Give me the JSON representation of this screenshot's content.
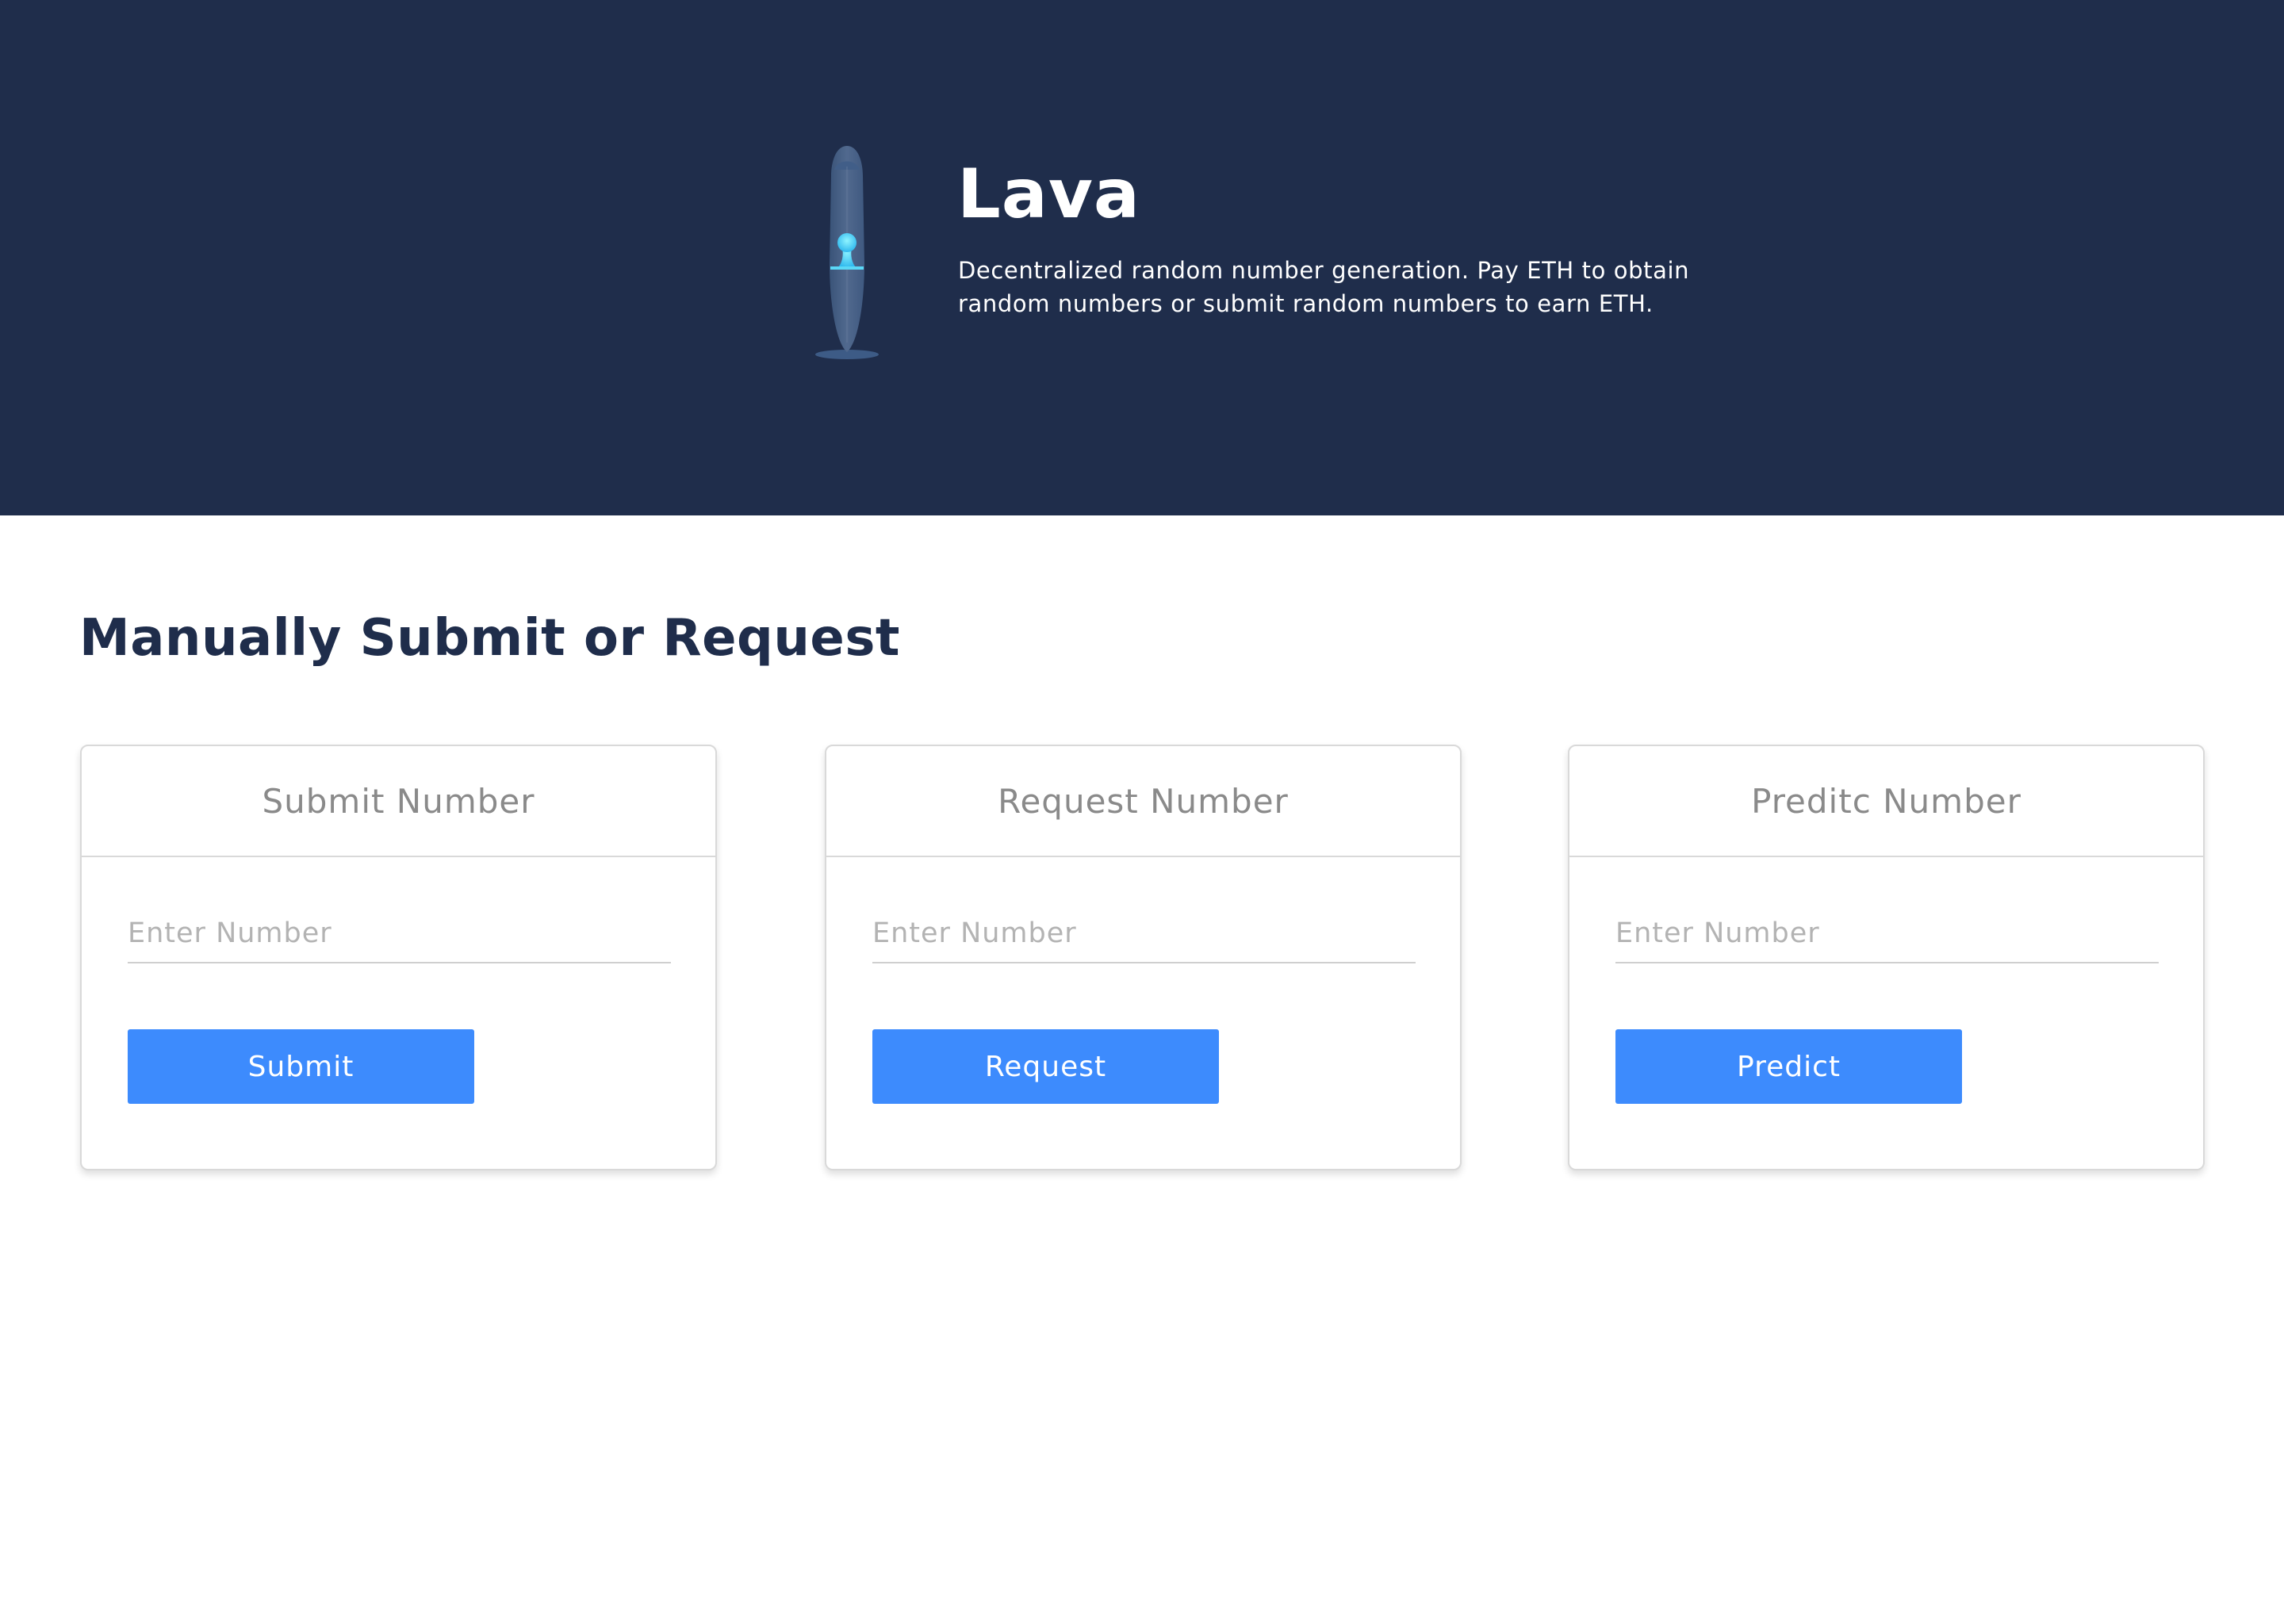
{
  "hero": {
    "title": "Lava",
    "description": "Decentralized random number generation. Pay ETH to obtain random numbers or submit  random numbers to earn ETH.",
    "background_color": "#1f2d4b",
    "logo_icon": "lava-lamp-icon"
  },
  "section": {
    "title": "Manually Submit or Request"
  },
  "cards": [
    {
      "title": "Submit Number",
      "input_placeholder": "Enter Number",
      "input_value": "",
      "button_label": "Submit"
    },
    {
      "title": "Request Number",
      "input_placeholder": "Enter Number",
      "input_value": "",
      "button_label": "Request"
    },
    {
      "title": "Preditc Number",
      "input_placeholder": "Enter Number",
      "input_value": "",
      "button_label": "Predict"
    }
  ],
  "colors": {
    "accent": "#3d8bfd",
    "heading": "#1f2d4b",
    "card_title": "#8a8a8a",
    "placeholder": "#b3b3b3"
  }
}
